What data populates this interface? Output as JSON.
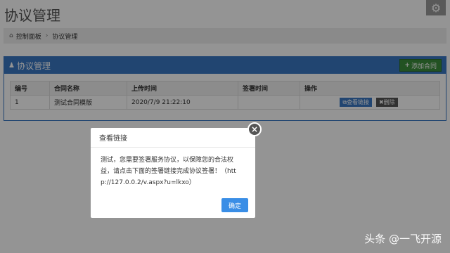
{
  "header": {
    "title": "协议管理",
    "settings_icon": "gear-icon"
  },
  "breadcrumb": {
    "home": "控制面板",
    "current": "协议管理"
  },
  "panel": {
    "title": "协议管理",
    "add_button": "添加合同"
  },
  "table": {
    "columns": [
      "编号",
      "合同名称",
      "上传时间",
      "签署时间",
      "操作"
    ],
    "rows": [
      {
        "id": "1",
        "name": "测试合同模版",
        "upload_time": "2020/7/9 21:22:10",
        "sign_time": "",
        "view_label": "查看链接",
        "delete_label": "删除"
      }
    ]
  },
  "modal": {
    "title": "查看链接",
    "line1": "测试，您需要签署服务协议，以保障您的合法权",
    "line2": "益，请点击下面的签署链接完成协议签署！（htt",
    "line3": "p://127.0.0.2/v.aspx?u=lkxo）",
    "ok_label": "确定",
    "close_symbol": "×"
  },
  "watermark": "头条 @一飞开源",
  "colors": {
    "primary": "#3a78c3",
    "success": "#3c8d3c",
    "ok": "#3a8ee6"
  }
}
